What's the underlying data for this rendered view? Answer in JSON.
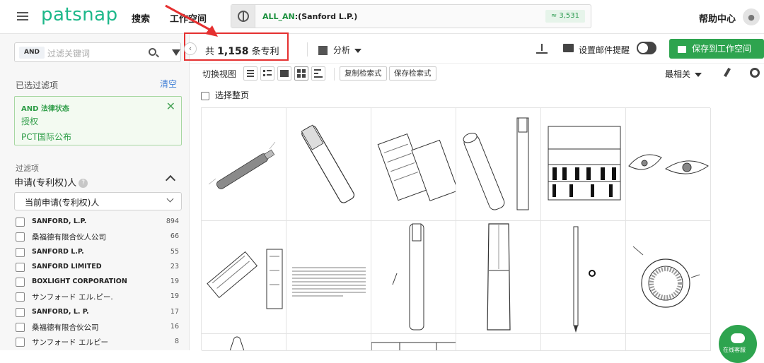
{
  "header": {
    "logo": "patsnap",
    "nav": [
      "搜索",
      "工作空间"
    ],
    "query_field": "ALL_AN",
    "query_value": ":(Sanford L.P.)",
    "query_count": "≈ 3,531",
    "help": "帮助中心"
  },
  "sidebar": {
    "and_tag": "AND",
    "filter_placeholder": "过滤关键词",
    "selected_title": "已选过滤项",
    "clear": "清空",
    "applied": {
      "title": "AND 法律状态",
      "line1": "授权",
      "line2": "PCT国际公布"
    },
    "filters_label": "过滤项",
    "applicant_label": "申请(专利权)人",
    "applicant_dropdown": "当前申请(专利权)人",
    "facets": [
      {
        "name": "SANFORD, L.P.",
        "count": "894",
        "cjk": false
      },
      {
        "name": "桑福德有限合伙人公司",
        "count": "66",
        "cjk": true
      },
      {
        "name": "SANFORD L.P.",
        "count": "55",
        "cjk": false
      },
      {
        "name": "SANFORD LIMITED",
        "count": "23",
        "cjk": false
      },
      {
        "name": "BOXLIGHT CORPORATION",
        "count": "19",
        "cjk": false
      },
      {
        "name": "サンフォード エル.ピー.",
        "count": "19",
        "cjk": true
      },
      {
        "name": "SANFORD, L. P.",
        "count": "17",
        "cjk": false
      },
      {
        "name": "桑福德有限合伙公司",
        "count": "16",
        "cjk": true
      },
      {
        "name": "サンフォード エルピー",
        "count": "8",
        "cjk": true
      }
    ]
  },
  "results": {
    "total_prefix": "共",
    "total_count": "1,158",
    "total_suffix": "条专利",
    "analysis": "分析",
    "email_alert": "设置邮件提醒",
    "save_workspace": "保存到工作空间",
    "switch_view": "切换视图",
    "copy_query": "复制检索式",
    "save_query": "保存检索式",
    "sort": "最相关",
    "select_page": "选择整页"
  },
  "fab_label": "在线客服",
  "colors": {
    "brand": "#1db88a",
    "save_green": "#2ea44f",
    "highlight_red": "#e53030",
    "link_blue": "#3a7bd5"
  }
}
